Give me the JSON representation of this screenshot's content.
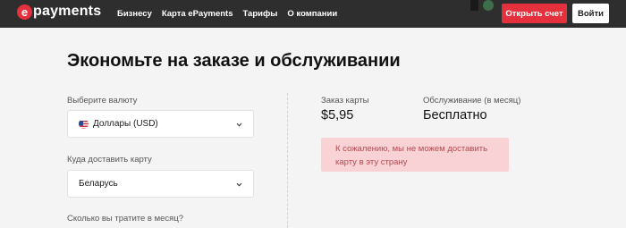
{
  "header": {
    "logo_mark": "e",
    "logo_text": "payments",
    "nav": [
      {
        "label": "Бизнесу"
      },
      {
        "label": "Карта ePayments"
      },
      {
        "label": "Тарифы"
      },
      {
        "label": "О компании"
      }
    ],
    "open_account_label": "Открыть счет",
    "login_label": "Войти"
  },
  "main": {
    "title": "Экономьте на заказе и обслуживании",
    "currency": {
      "label": "Выберите валюту",
      "value": "Доллары (USD)",
      "flag_icon": "us-flag-icon"
    },
    "delivery": {
      "label": "Куда доставить карту",
      "value": "Беларусь"
    },
    "spend_label": "Сколько вы тратите в месяц?"
  },
  "summary": {
    "card_order_label": "Заказ карты",
    "card_order_value": "$5,95",
    "service_label": "Обслуживание (в месяц)",
    "service_value": "Бесплатно",
    "alert_text": "К сожалению, мы не можем доставить карту в эту страну"
  },
  "colors": {
    "brand_red": "#e5313d",
    "header_bg": "#2e2e2e",
    "page_bg": "#f4f4f4",
    "alert_bg": "#f8d2d5",
    "alert_text": "#b44a52"
  }
}
